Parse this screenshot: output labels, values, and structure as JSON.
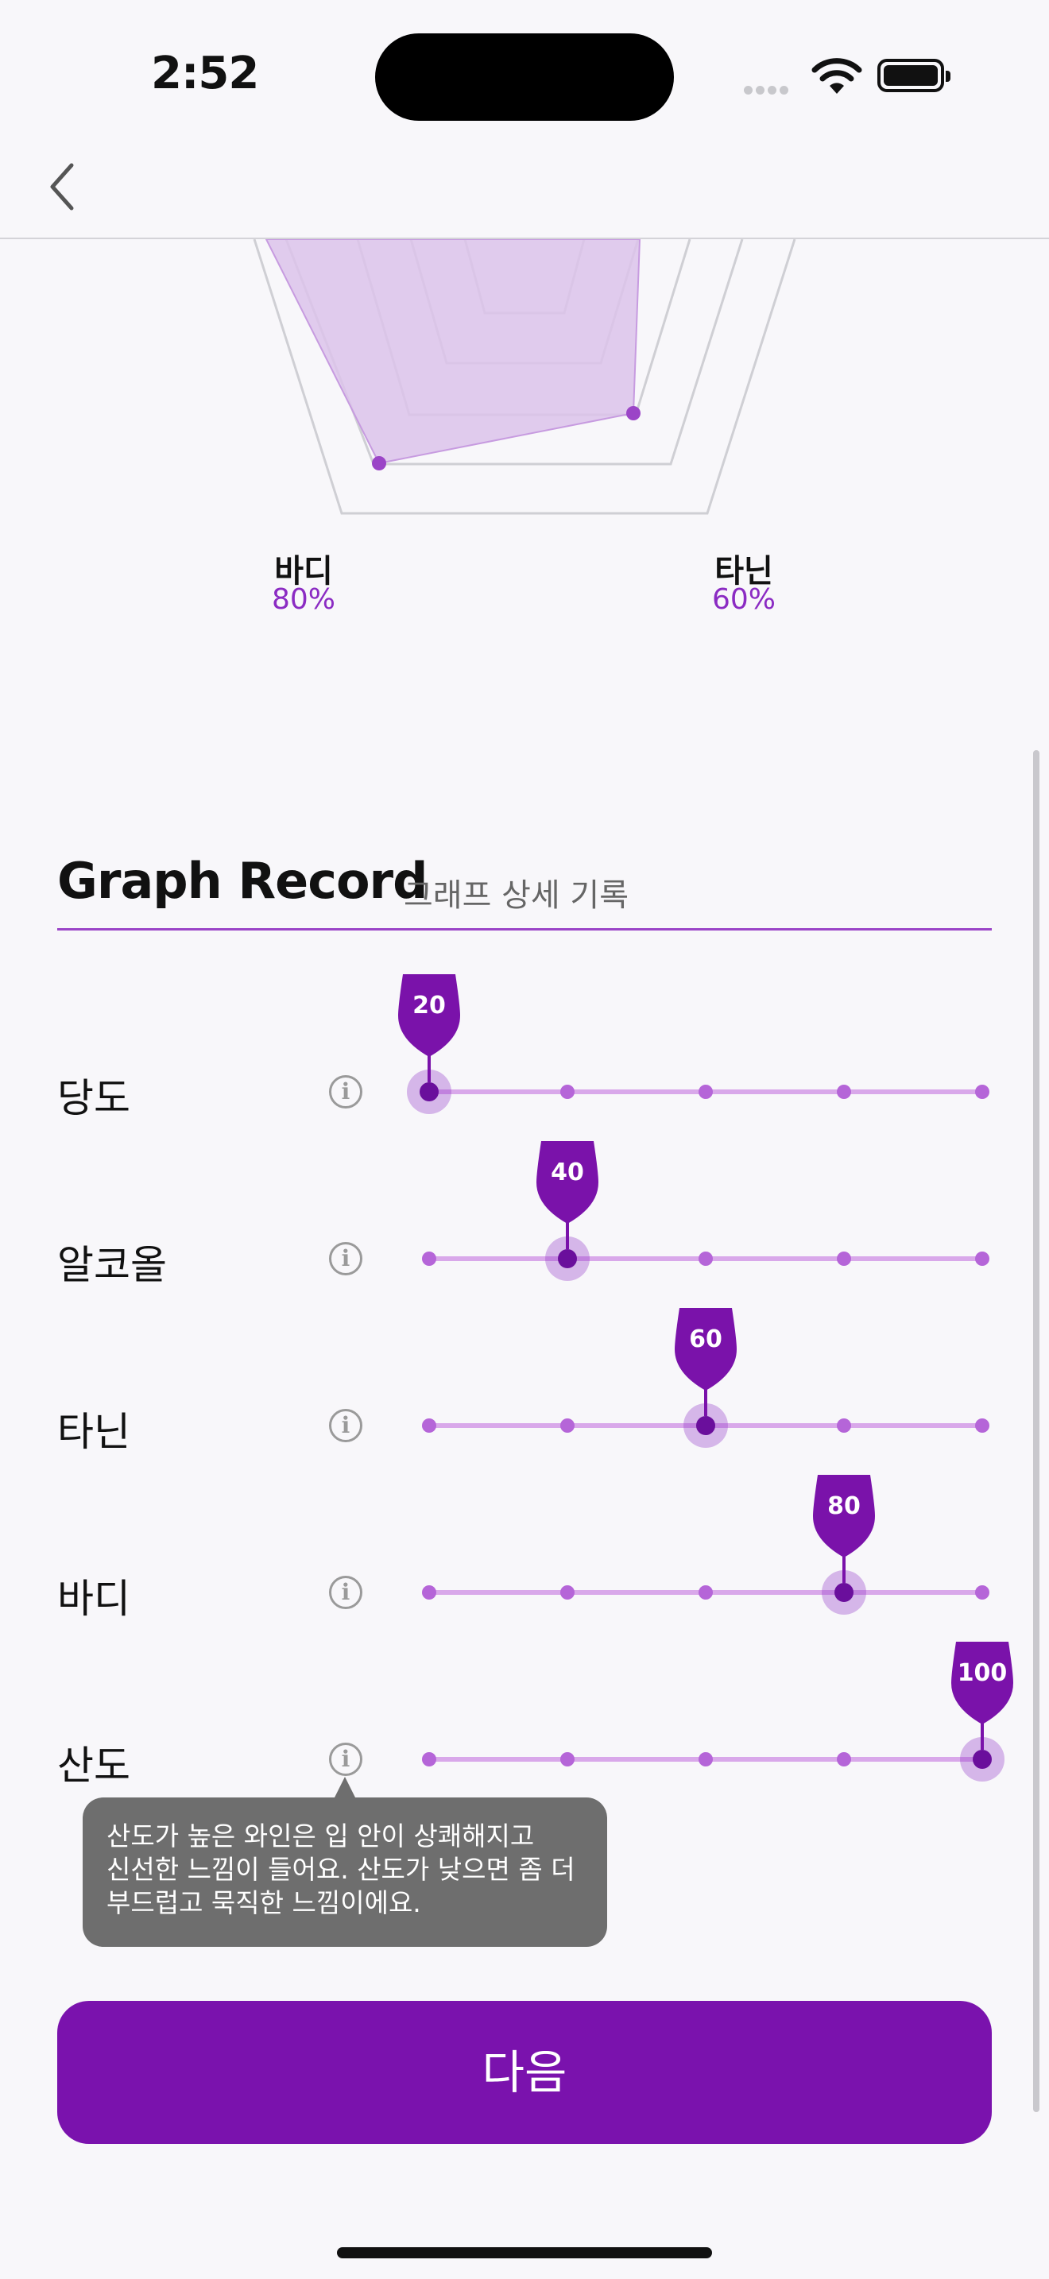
{
  "status_bar": {
    "time": "2:52"
  },
  "radar": {
    "labels": [
      {
        "name": "바디",
        "value": "80%"
      },
      {
        "name": "타닌",
        "value": "60%"
      }
    ]
  },
  "section": {
    "title": "Graph Record",
    "subtitle": "그래프 상세 기록"
  },
  "sliders": [
    {
      "label": "당도",
      "value": 20,
      "value_text": "20"
    },
    {
      "label": "알코올",
      "value": 40,
      "value_text": "40"
    },
    {
      "label": "타닌",
      "value": 60,
      "value_text": "60"
    },
    {
      "label": "바디",
      "value": 80,
      "value_text": "80"
    },
    {
      "label": "산도",
      "value": 100,
      "value_text": "100"
    }
  ],
  "slider_ticks": [
    20,
    40,
    60,
    80,
    100
  ],
  "tooltip": {
    "lines": [
      "산도가 높은 와인은 입 안이 상쾌해지고",
      "신선한 느낌이 들어요. 산도가 낮으면 좀 더",
      "부드럽고 묵직한 느낌이에요."
    ]
  },
  "next_button": {
    "label": "다음"
  },
  "colors": {
    "accent": "#7a12ad",
    "accent_light": "#d9a8ea",
    "radar_fill": "#dcc3ea"
  }
}
